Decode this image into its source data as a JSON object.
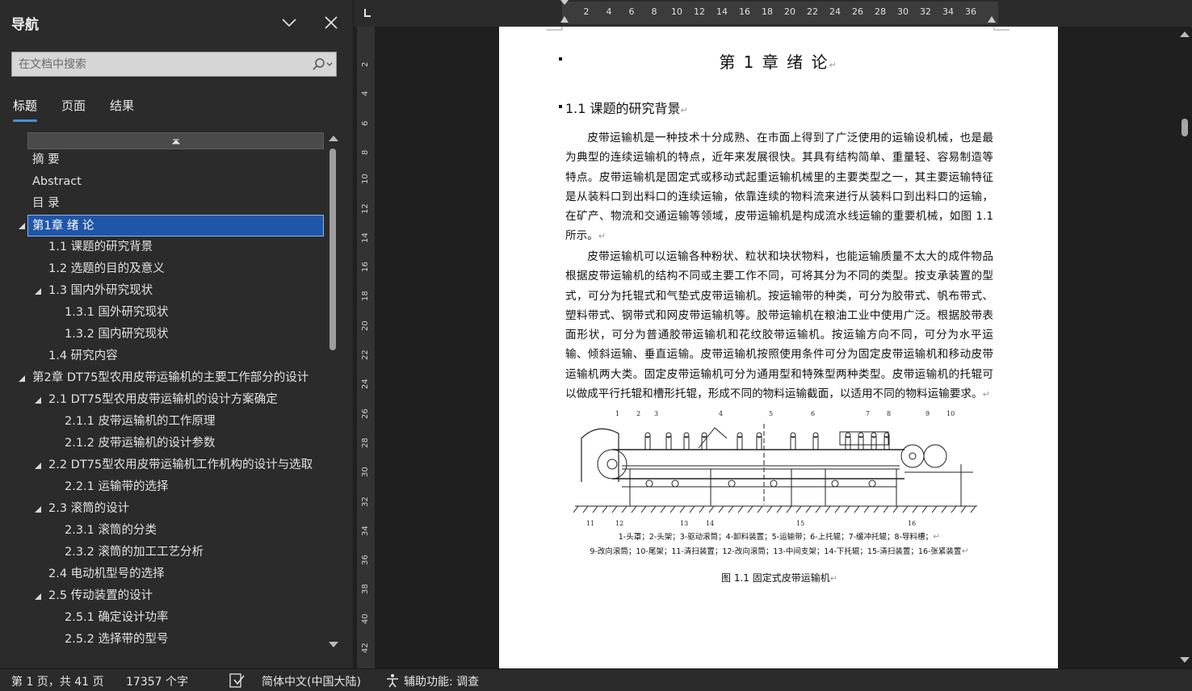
{
  "nav": {
    "title": "导航",
    "search_placeholder": "在文档中搜索",
    "tabs": [
      "标题",
      "页面",
      "结果"
    ],
    "headings": [
      {
        "label": "摘  要",
        "level": 1,
        "caret": false,
        "selected": false
      },
      {
        "label": "Abstract",
        "level": 1,
        "caret": false,
        "selected": false
      },
      {
        "label": "目  录",
        "level": 1,
        "caret": false,
        "selected": false
      },
      {
        "label": "第1章 绪  论",
        "level": 1,
        "caret": true,
        "selected": true
      },
      {
        "label": "1.1 课题的研究背景",
        "level": 2,
        "caret": false,
        "selected": false
      },
      {
        "label": "1.2 选题的目的及意义",
        "level": 2,
        "caret": false,
        "selected": false
      },
      {
        "label": "1.3 国内外研究现状",
        "level": 2,
        "caret": true,
        "selected": false
      },
      {
        "label": "1.3.1 国外研究现状",
        "level": 3,
        "caret": false,
        "selected": false
      },
      {
        "label": "1.3.2 国内研究现状",
        "level": 3,
        "caret": false,
        "selected": false
      },
      {
        "label": "1.4 研究内容",
        "level": 2,
        "caret": false,
        "selected": false
      },
      {
        "label": "第2章 DT75型农用皮带运输机的主要工作部分的设计",
        "level": 1,
        "caret": true,
        "selected": false
      },
      {
        "label": "2.1 DT75型农用皮带运输机的设计方案确定",
        "level": 2,
        "caret": true,
        "selected": false
      },
      {
        "label": "2.1.1 皮带运输机的工作原理",
        "level": 3,
        "caret": false,
        "selected": false
      },
      {
        "label": "2.1.2 皮带运输机的设计参数",
        "level": 3,
        "caret": false,
        "selected": false
      },
      {
        "label": "2.2 DT75型农用皮带运输机工作机构的设计与选取",
        "level": 2,
        "caret": true,
        "selected": false
      },
      {
        "label": "2.2.1 运输带的选择",
        "level": 3,
        "caret": false,
        "selected": false
      },
      {
        "label": "2.3 滚筒的设计",
        "level": 2,
        "caret": true,
        "selected": false
      },
      {
        "label": "2.3.1 滚筒的分类",
        "level": 3,
        "caret": false,
        "selected": false
      },
      {
        "label": "2.3.2 滚筒的加工工艺分析",
        "level": 3,
        "caret": false,
        "selected": false
      },
      {
        "label": "2.4 电动机型号的选择",
        "level": 2,
        "caret": false,
        "selected": false
      },
      {
        "label": "2.5 传动装置的设计",
        "level": 2,
        "caret": true,
        "selected": false
      },
      {
        "label": "2.5.1 确定设计功率",
        "level": 3,
        "caret": false,
        "selected": false
      },
      {
        "label": "2.5.2 选择带的型号",
        "level": 3,
        "caret": false,
        "selected": false
      }
    ]
  },
  "ruler": {
    "h_numbers": [
      "2",
      "4",
      "6",
      "8",
      "10",
      "12",
      "14",
      "16",
      "18",
      "20",
      "22",
      "24",
      "26",
      "28",
      "30",
      "32",
      "34",
      "36"
    ],
    "v_numbers": [
      "2",
      "4",
      "6",
      "8",
      "10",
      "12",
      "14",
      "16",
      "18",
      "20",
      "22",
      "24",
      "26",
      "28",
      "30",
      "32",
      "34",
      "36",
      "38",
      "40",
      "42"
    ]
  },
  "document": {
    "chapter_title": "第 1 章  绪  论",
    "section_title": "1.1  课题的研究背景",
    "para1": "皮带运输机是一种技术十分成熟、在市面上得到了广泛使用的运输设机械，也是最为典型的连续运输机的特点，近年来发展很快。其具有结构简单、重量轻、容易制造等特点。皮带运输机是固定式或移动式起重运输机械里的主要类型之一，其主要运输特征是从装料口到出料口的连续运输，依靠连续的物料流来进行从装料口到出料口的运输，在矿产、物流和交通运输等领域，皮带运输机是构成流水线运输的重要机械，如图 1.1 所示。",
    "para2": "皮带运输机可以运输各种粉状、粒状和块状物料，也能运输质量不太大的成件物品根据皮带运输机的结构不同或主要工作不同，可将其分为不同的类型。按支承装置的型式，可分为托辊式和气垫式皮带运输机。按运输带的种类，可分为胶带式、帆布带式、塑料带式、钢带式和网皮带运输机等。胶带运输机在粮油工业中使用广泛。根据胶带表面形状，可分为普通胶带运输机和花纹胶带运输机。按运输方向不同，可分为水平运输、倾斜运输、垂直运输。皮带运输机按照使用条件可分为固定皮带运输机和移动皮带运输机两大类。固定皮带运输机可分为通用型和特殊型两种类型。皮带运输机的托辊可以做成平行托辊和槽形托辊，形成不同的物料运输截面，以适用不同的物料运输要求。",
    "figure_numbers_top": [
      "1",
      "2",
      "3",
      "4",
      "5",
      "6",
      "7",
      "8",
      "9",
      "10"
    ],
    "figure_numbers_bottom": [
      "11",
      "12",
      "13",
      "14",
      "15",
      "16"
    ],
    "legend_line1": "1-头罩；2-头架；3-驱动滚筒；4-卸料装置；5-运输带；6-上托辊；7-缓冲托辊；8-导料槽；",
    "legend_line2": "9-改向滚筒；10-尾架；11-清扫装置；12-改向滚筒；13-中间支架；14-下托辊；15-清扫装置；16-张紧装置",
    "figure_caption": "图 1.1  固定式皮带运输机"
  },
  "status": {
    "page": "第 1 页，共 41 页",
    "words": "17357 个字",
    "language": "简体中文(中国大陆)",
    "accessibility": "辅助功能: 调查"
  }
}
